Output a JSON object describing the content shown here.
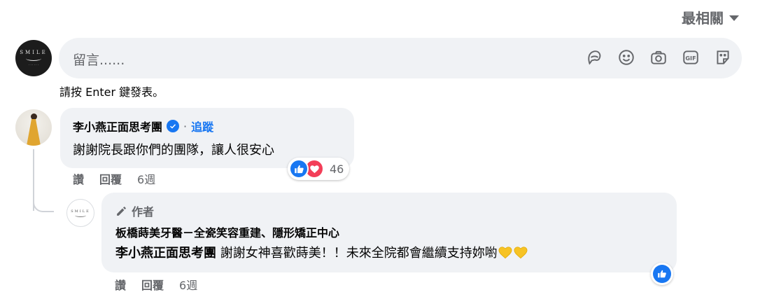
{
  "sort": {
    "label": "最相關"
  },
  "composer": {
    "placeholder": "留言......",
    "icons": [
      "avatar-sticker-icon",
      "emoji-icon",
      "camera-icon",
      "gif-icon",
      "sticker-icon"
    ]
  },
  "hint": "請按 Enter 鍵發表。",
  "comment": {
    "author": "李小燕正面思考團",
    "separator": "·",
    "follow_label": "追蹤",
    "text": "謝謝院長跟你們的團隊，讓人很安心",
    "reaction_count": "46",
    "actions": {
      "like": "讚",
      "reply": "回覆",
      "time": "6週"
    }
  },
  "reply": {
    "author_badge": "作者",
    "page_name": "板橋蒔美牙醫－全瓷笑容重建、隱形矯正中心",
    "mention": "李小燕正面思考團",
    "text": " 謝謝女神喜歡蒔美！！未來全院都會繼續支持妳喲",
    "actions": {
      "like": "讚",
      "reply": "回覆",
      "time": "6週"
    }
  },
  "colors": {
    "accent": "#1877f2",
    "bubble": "#f0f2f5",
    "muted": "#65676b",
    "love": "#f33e58"
  }
}
